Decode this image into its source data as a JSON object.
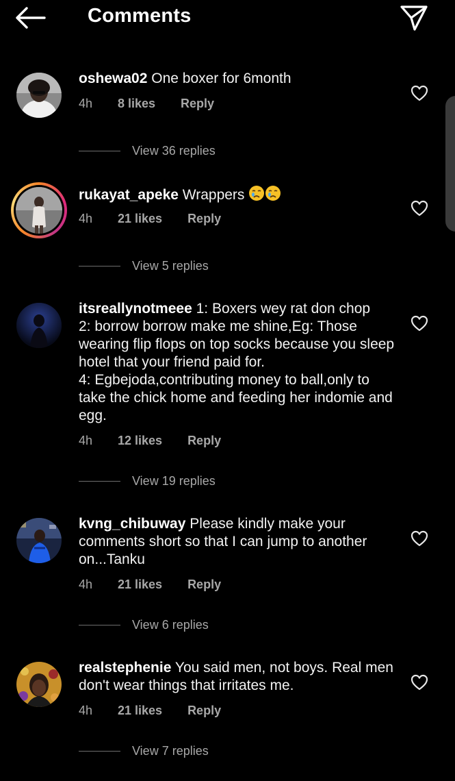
{
  "header": {
    "title": "Comments",
    "back_icon": "arrow-left-icon",
    "share_icon": "paper-plane-icon"
  },
  "colors": {
    "background": "#000000",
    "text": "#ffffff",
    "secondary_text": "#a8a8a8",
    "story_ring_start": "#f58529",
    "story_ring_end": "#dd2a7b"
  },
  "comments": [
    {
      "username": "oshewa02",
      "text": "One boxer for 6month",
      "time": "4h",
      "likes": "8 likes",
      "reply": "Reply",
      "view_replies": "View 36 replies",
      "has_story": false
    },
    {
      "username": "rukayat_apeke",
      "text": "Wrappers",
      "emojis": [
        "crying-face-icon",
        "crying-face-icon"
      ],
      "time": "4h",
      "likes": "21 likes",
      "reply": "Reply",
      "view_replies": "View 5 replies",
      "has_story": true
    },
    {
      "username": "itsreallynotmeee",
      "text": "1: Boxers wey rat don chop\n2: borrow borrow make me shine,Eg: Those wearing flip flops on top socks because you sleep hotel that your friend paid for.\n4: Egbejoda,contributing money to ball,only to take the chick home and feeding her indomie and egg.",
      "time": "4h",
      "likes": "12 likes",
      "reply": "Reply",
      "view_replies": "View 19 replies",
      "has_story": false
    },
    {
      "username": "kvng_chibuway",
      "text": "Please kindly make your comments short so that I can jump to another on...Tanku",
      "time": "4h",
      "likes": "21 likes",
      "reply": "Reply",
      "view_replies": "View 6 replies",
      "has_story": false
    },
    {
      "username": "realstephenie",
      "text": "You said men, not boys. Real men don't wear things that irritates me.",
      "time": "4h",
      "likes": "21 likes",
      "reply": "Reply",
      "view_replies": "View 7 replies",
      "has_story": false
    }
  ]
}
